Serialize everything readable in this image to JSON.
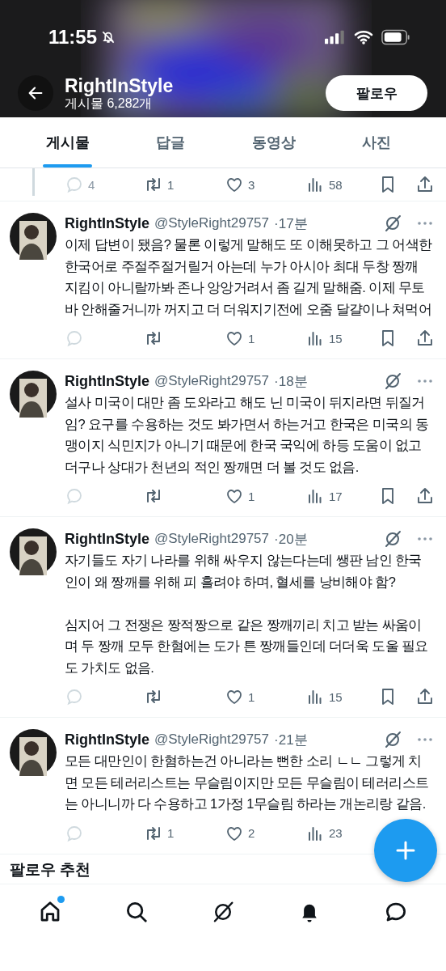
{
  "status_bar": {
    "time": "11:55"
  },
  "profile_header": {
    "name": "RightInStyle",
    "post_count": "게시물 6,282개",
    "follow_button": "팔로우"
  },
  "tabs": [
    {
      "label": "게시물",
      "selected": true
    },
    {
      "label": "답글",
      "selected": false
    },
    {
      "label": "동영상",
      "selected": false
    },
    {
      "label": "사진",
      "selected": false
    }
  ],
  "previous_post": {
    "actions": {
      "kind": "full",
      "replies": "4",
      "reposts": "1",
      "likes": "3",
      "views": "58"
    }
  },
  "posts": [
    {
      "name": "RightInStyle",
      "handle": "@StyleRight29757",
      "time": "·17분",
      "text": "이제 답변이 됐음? 물론 이렇게 말해도 또 이해못하고 그 어색한 한국어로 주절주절거릴거 아는데 누가 아시아 최대 두창 짱깨 지킴이 아니랄까봐 존나 앙앙거려서 좀 길게 말해줌. 이제 무토바 안해줄거니까 꺼지고 더 더워지기전에 오줌 달걀이나 쳐먹어",
      "actions": {
        "kind": "full",
        "likes": "1",
        "views": "15"
      }
    },
    {
      "name": "RightInStyle",
      "handle": "@StyleRight29757",
      "time": "·18분",
      "text": "설사 미국이 대만 좀 도와라고 해도 닌 미국이 뒤지라면 뒤질거임? 요구를 수용하는 것도 봐가면서 하는거고 한국은 미국의 동맹이지 식민지가 아니기 때문에 한국 국익에 하등 도움이 없고 더구나 상대가 천년의 적인 짱깨면 더 볼 것도 없음.",
      "actions": {
        "kind": "full",
        "likes": "1",
        "views": "17"
      }
    },
    {
      "name": "RightInStyle",
      "handle": "@StyleRight29757",
      "time": "·20분",
      "text": "자기들도 자기 나라를 위해 싸우지 않는다는데 쌩판 남인 한국인이 왜 짱깨를 위해 피 흘려야 하며, 혈세를 낭비해야 함?\n\n심지어 그 전쟁은 짱적짱으로 같은 짱깨끼리 치고 받는 싸움이며 두 짱깨 모두 한혐에는 도가 튼 짱깨들인데 더더욱 도울 필요도 가치도 없음.",
      "actions": {
        "kind": "full",
        "likes": "1",
        "views": "15"
      }
    },
    {
      "name": "RightInStyle",
      "handle": "@StyleRight29757",
      "time": "·21분",
      "text": "모든 대만인이 한혐하는건 아니라는 뻔한 소리 ㄴㄴ 그렇게 치면 모든 테러리스트는 무슬림이지만 모든 무슬림이 테러리스트는 아니니까 다 수용하고 1가정 1무슬림 하라는 개논리랑 같음.",
      "actions": {
        "kind": "partial",
        "reposts": "1",
        "likes": "2",
        "views": "23"
      }
    }
  ],
  "section_heading": "팔로우 추천",
  "bottom_nav": [
    {
      "kind": "home",
      "badge": true
    },
    {
      "kind": "search",
      "badge": false
    },
    {
      "kind": "grok",
      "badge": false
    },
    {
      "kind": "notifications",
      "badge": false
    },
    {
      "kind": "messages",
      "badge": false
    }
  ]
}
